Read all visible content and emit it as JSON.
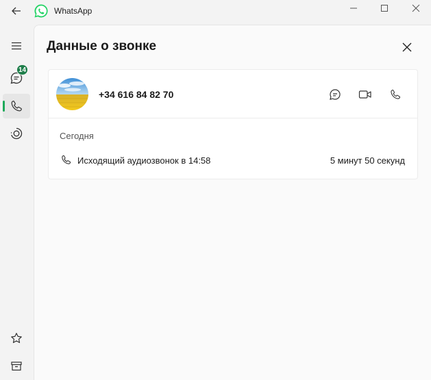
{
  "window": {
    "title": "WhatsApp"
  },
  "sidebar": {
    "items": [
      {
        "name": "menu",
        "icon": "hamburger-icon"
      },
      {
        "name": "chats",
        "icon": "chat-icon",
        "badge": "14"
      },
      {
        "name": "calls",
        "icon": "phone-icon",
        "active": true
      },
      {
        "name": "status",
        "icon": "status-icon"
      },
      {
        "name": "starred",
        "icon": "star-icon"
      },
      {
        "name": "archived",
        "icon": "archive-icon"
      }
    ]
  },
  "page": {
    "title": "Данные о звонке"
  },
  "contact": {
    "phone": "+34 616 84 82 70"
  },
  "calls": {
    "section_label": "Сегодня",
    "items": [
      {
        "description": "Исходящий аудиозвонок в 14:58",
        "duration": "5 минут 50 секунд"
      }
    ]
  },
  "colors": {
    "accent": "#1da95a",
    "badge": "#1e7e4a",
    "logo": "#25d366"
  }
}
